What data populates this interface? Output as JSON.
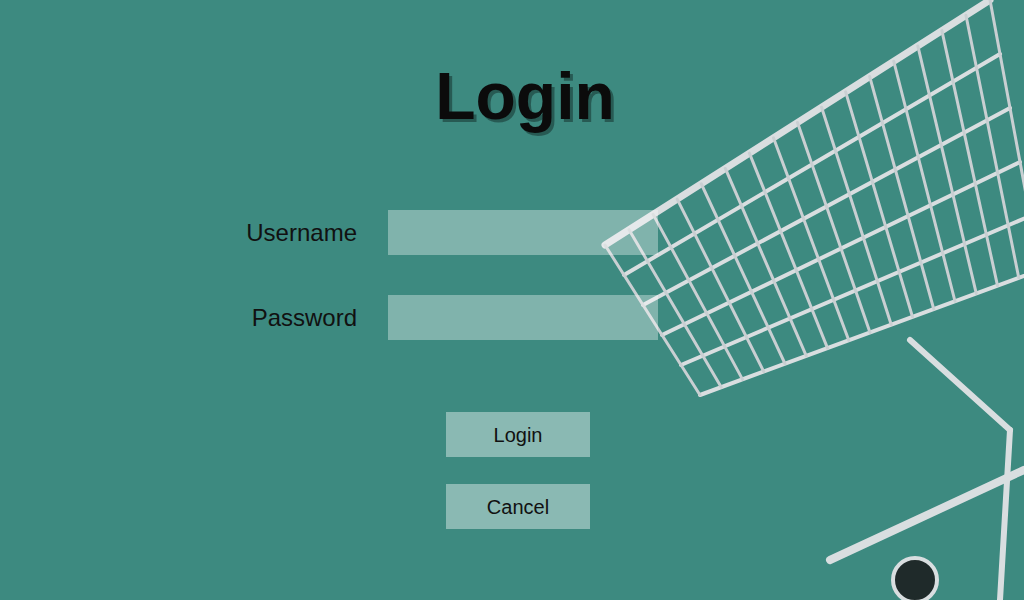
{
  "title": "Login",
  "fields": [
    {
      "label": "Username"
    },
    {
      "label": "Password"
    }
  ],
  "buttons": [
    "Login",
    "Cancel"
  ]
}
